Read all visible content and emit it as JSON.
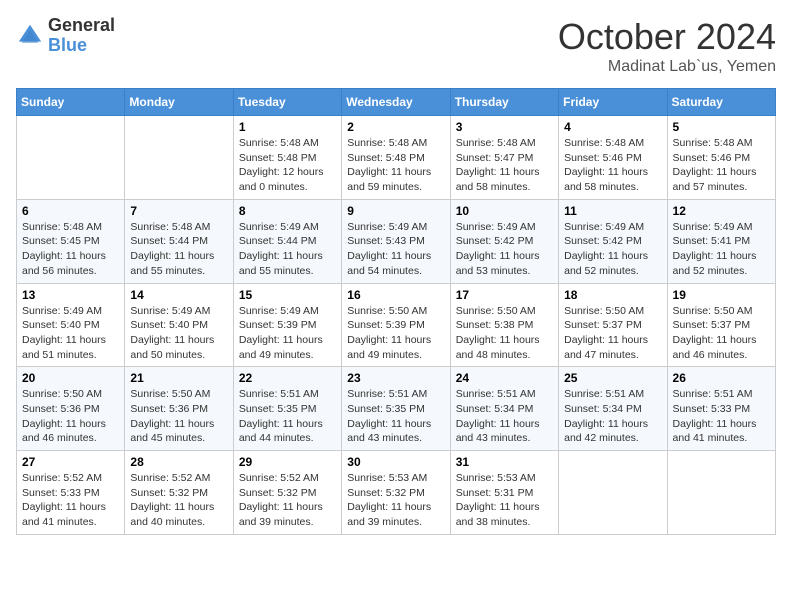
{
  "header": {
    "logo_general": "General",
    "logo_blue": "Blue",
    "month": "October 2024",
    "location": "Madinat Lab`us, Yemen"
  },
  "days_of_week": [
    "Sunday",
    "Monday",
    "Tuesday",
    "Wednesday",
    "Thursday",
    "Friday",
    "Saturday"
  ],
  "weeks": [
    [
      {
        "day": "",
        "sunrise": "",
        "sunset": "",
        "daylight": ""
      },
      {
        "day": "",
        "sunrise": "",
        "sunset": "",
        "daylight": ""
      },
      {
        "day": "1",
        "sunrise": "Sunrise: 5:48 AM",
        "sunset": "Sunset: 5:48 PM",
        "daylight": "Daylight: 12 hours and 0 minutes."
      },
      {
        "day": "2",
        "sunrise": "Sunrise: 5:48 AM",
        "sunset": "Sunset: 5:48 PM",
        "daylight": "Daylight: 11 hours and 59 minutes."
      },
      {
        "day": "3",
        "sunrise": "Sunrise: 5:48 AM",
        "sunset": "Sunset: 5:47 PM",
        "daylight": "Daylight: 11 hours and 58 minutes."
      },
      {
        "day": "4",
        "sunrise": "Sunrise: 5:48 AM",
        "sunset": "Sunset: 5:46 PM",
        "daylight": "Daylight: 11 hours and 58 minutes."
      },
      {
        "day": "5",
        "sunrise": "Sunrise: 5:48 AM",
        "sunset": "Sunset: 5:46 PM",
        "daylight": "Daylight: 11 hours and 57 minutes."
      }
    ],
    [
      {
        "day": "6",
        "sunrise": "Sunrise: 5:48 AM",
        "sunset": "Sunset: 5:45 PM",
        "daylight": "Daylight: 11 hours and 56 minutes."
      },
      {
        "day": "7",
        "sunrise": "Sunrise: 5:48 AM",
        "sunset": "Sunset: 5:44 PM",
        "daylight": "Daylight: 11 hours and 55 minutes."
      },
      {
        "day": "8",
        "sunrise": "Sunrise: 5:49 AM",
        "sunset": "Sunset: 5:44 PM",
        "daylight": "Daylight: 11 hours and 55 minutes."
      },
      {
        "day": "9",
        "sunrise": "Sunrise: 5:49 AM",
        "sunset": "Sunset: 5:43 PM",
        "daylight": "Daylight: 11 hours and 54 minutes."
      },
      {
        "day": "10",
        "sunrise": "Sunrise: 5:49 AM",
        "sunset": "Sunset: 5:42 PM",
        "daylight": "Daylight: 11 hours and 53 minutes."
      },
      {
        "day": "11",
        "sunrise": "Sunrise: 5:49 AM",
        "sunset": "Sunset: 5:42 PM",
        "daylight": "Daylight: 11 hours and 52 minutes."
      },
      {
        "day": "12",
        "sunrise": "Sunrise: 5:49 AM",
        "sunset": "Sunset: 5:41 PM",
        "daylight": "Daylight: 11 hours and 52 minutes."
      }
    ],
    [
      {
        "day": "13",
        "sunrise": "Sunrise: 5:49 AM",
        "sunset": "Sunset: 5:40 PM",
        "daylight": "Daylight: 11 hours and 51 minutes."
      },
      {
        "day": "14",
        "sunrise": "Sunrise: 5:49 AM",
        "sunset": "Sunset: 5:40 PM",
        "daylight": "Daylight: 11 hours and 50 minutes."
      },
      {
        "day": "15",
        "sunrise": "Sunrise: 5:49 AM",
        "sunset": "Sunset: 5:39 PM",
        "daylight": "Daylight: 11 hours and 49 minutes."
      },
      {
        "day": "16",
        "sunrise": "Sunrise: 5:50 AM",
        "sunset": "Sunset: 5:39 PM",
        "daylight": "Daylight: 11 hours and 49 minutes."
      },
      {
        "day": "17",
        "sunrise": "Sunrise: 5:50 AM",
        "sunset": "Sunset: 5:38 PM",
        "daylight": "Daylight: 11 hours and 48 minutes."
      },
      {
        "day": "18",
        "sunrise": "Sunrise: 5:50 AM",
        "sunset": "Sunset: 5:37 PM",
        "daylight": "Daylight: 11 hours and 47 minutes."
      },
      {
        "day": "19",
        "sunrise": "Sunrise: 5:50 AM",
        "sunset": "Sunset: 5:37 PM",
        "daylight": "Daylight: 11 hours and 46 minutes."
      }
    ],
    [
      {
        "day": "20",
        "sunrise": "Sunrise: 5:50 AM",
        "sunset": "Sunset: 5:36 PM",
        "daylight": "Daylight: 11 hours and 46 minutes."
      },
      {
        "day": "21",
        "sunrise": "Sunrise: 5:50 AM",
        "sunset": "Sunset: 5:36 PM",
        "daylight": "Daylight: 11 hours and 45 minutes."
      },
      {
        "day": "22",
        "sunrise": "Sunrise: 5:51 AM",
        "sunset": "Sunset: 5:35 PM",
        "daylight": "Daylight: 11 hours and 44 minutes."
      },
      {
        "day": "23",
        "sunrise": "Sunrise: 5:51 AM",
        "sunset": "Sunset: 5:35 PM",
        "daylight": "Daylight: 11 hours and 43 minutes."
      },
      {
        "day": "24",
        "sunrise": "Sunrise: 5:51 AM",
        "sunset": "Sunset: 5:34 PM",
        "daylight": "Daylight: 11 hours and 43 minutes."
      },
      {
        "day": "25",
        "sunrise": "Sunrise: 5:51 AM",
        "sunset": "Sunset: 5:34 PM",
        "daylight": "Daylight: 11 hours and 42 minutes."
      },
      {
        "day": "26",
        "sunrise": "Sunrise: 5:51 AM",
        "sunset": "Sunset: 5:33 PM",
        "daylight": "Daylight: 11 hours and 41 minutes."
      }
    ],
    [
      {
        "day": "27",
        "sunrise": "Sunrise: 5:52 AM",
        "sunset": "Sunset: 5:33 PM",
        "daylight": "Daylight: 11 hours and 41 minutes."
      },
      {
        "day": "28",
        "sunrise": "Sunrise: 5:52 AM",
        "sunset": "Sunset: 5:32 PM",
        "daylight": "Daylight: 11 hours and 40 minutes."
      },
      {
        "day": "29",
        "sunrise": "Sunrise: 5:52 AM",
        "sunset": "Sunset: 5:32 PM",
        "daylight": "Daylight: 11 hours and 39 minutes."
      },
      {
        "day": "30",
        "sunrise": "Sunrise: 5:53 AM",
        "sunset": "Sunset: 5:32 PM",
        "daylight": "Daylight: 11 hours and 39 minutes."
      },
      {
        "day": "31",
        "sunrise": "Sunrise: 5:53 AM",
        "sunset": "Sunset: 5:31 PM",
        "daylight": "Daylight: 11 hours and 38 minutes."
      },
      {
        "day": "",
        "sunrise": "",
        "sunset": "",
        "daylight": ""
      },
      {
        "day": "",
        "sunrise": "",
        "sunset": "",
        "daylight": ""
      }
    ]
  ]
}
